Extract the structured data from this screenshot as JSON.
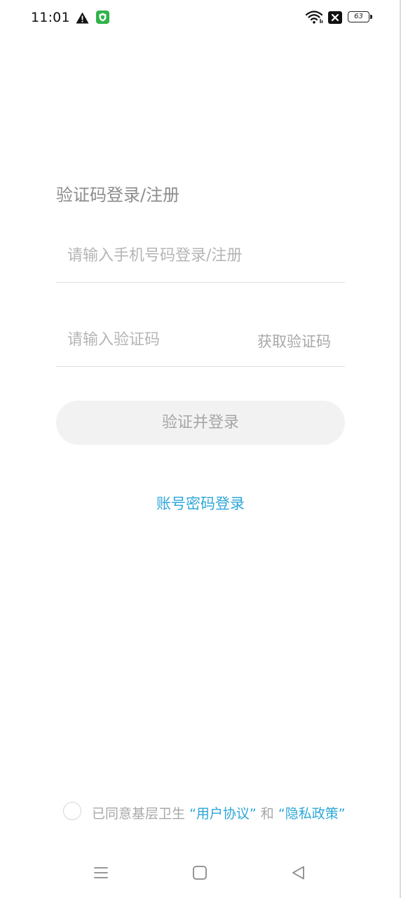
{
  "status_bar": {
    "time": "11:01",
    "battery_level": "63",
    "icons": [
      "warning-icon",
      "shield-app-icon",
      "wifi-icon",
      "sim-off-icon",
      "battery-icon"
    ]
  },
  "login": {
    "title": "验证码登录/注册",
    "phone_placeholder": "请输入手机号码登录/注册",
    "code_placeholder": "请输入验证码",
    "get_code_label": "获取验证码",
    "submit_label": "验证并登录",
    "account_login_label": "账号密码登录"
  },
  "agreement": {
    "prefix": "已同意基层卫生",
    "user_agreement": "“用户协议”",
    "conjunction": "和",
    "privacy_policy": "“隐私政策”",
    "checked": false
  },
  "nav_bar": {
    "buttons": [
      "menu-icon",
      "home-icon",
      "back-icon"
    ]
  },
  "colors": {
    "accent": "#2ea7d8",
    "button_bg": "#f2f2f2",
    "placeholder": "#b5b5b5",
    "divider": "#dedede"
  }
}
